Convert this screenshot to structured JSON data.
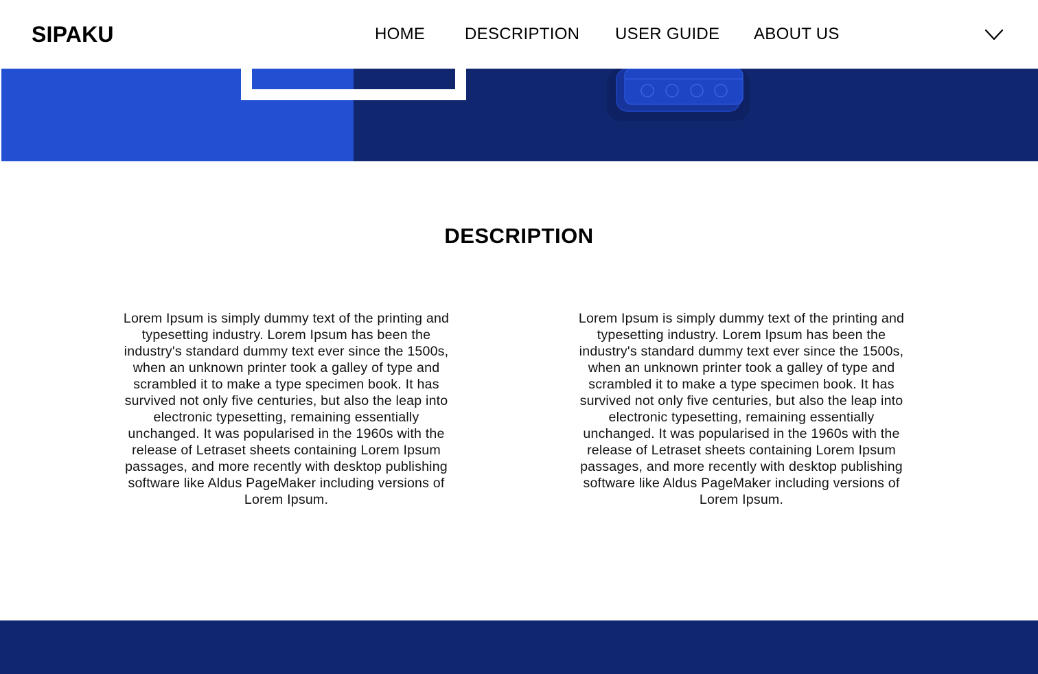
{
  "colors": {
    "navy": "#10266f",
    "blue": "#2350d2",
    "white": "#ffffff",
    "device_body": "#1b3a9f",
    "device_shadow": "#0c1e5c"
  },
  "header": {
    "brand": "SIPAKU",
    "nav": {
      "home": "HOME",
      "description": "DESCRIPTION",
      "user_guide": "USER GUIDE",
      "about_us": "ABOUT US"
    },
    "menu_icon": "chevron-down-icon"
  },
  "description": {
    "title": "DESCRIPTION",
    "left_text": "Lorem Ipsum is simply dummy text of the printing and typesetting industry. Lorem Ipsum has been the industry's standard dummy text ever since the 1500s, when an unknown printer took a galley of type and scrambled it to make a type specimen book. It has survived not only five centuries, but also the leap into electronic typesetting, remaining essentially unchanged. It was popularised in the 1960s with the release of Letraset sheets containing Lorem Ipsum passages, and more recently with desktop publishing software like Aldus PageMaker including versions of Lorem Ipsum.",
    "right_text": "Lorem Ipsum is simply dummy text of the printing and typesetting industry. Lorem Ipsum has been the industry's standard dummy text ever since the 1500s, when an unknown printer took a galley of type and scrambled it to make a type specimen book. It has survived not only five centuries, but also the leap into electronic typesetting, remaining essentially unchanged. It was popularised in the 1960s with the release of Letraset sheets containing Lorem Ipsum passages, and more recently with desktop publishing software like Aldus PageMaker including versions of Lorem Ipsum."
  }
}
